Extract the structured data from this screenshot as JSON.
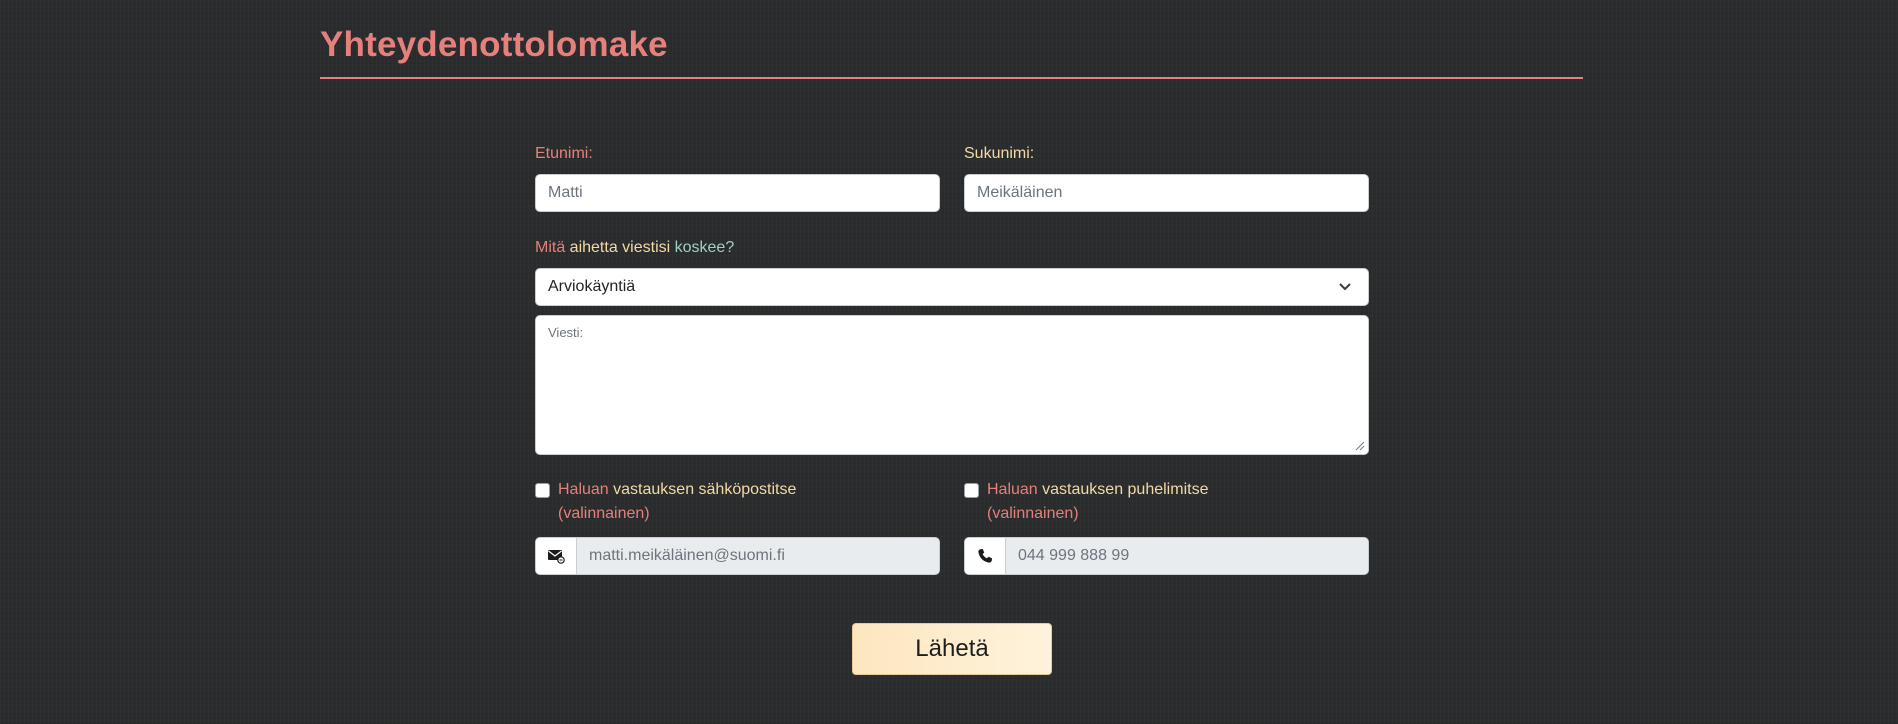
{
  "header": {
    "title": "Yhteydenottolomake"
  },
  "form": {
    "first_name": {
      "label": "Etunimi:",
      "placeholder": "Matti"
    },
    "last_name": {
      "label": "Sukunimi:",
      "placeholder": "Meikäläinen"
    },
    "topic": {
      "label_parts": [
        "Mitä",
        " aihetta viestisi",
        " koskee?"
      ],
      "selected": "Arviokäyntiä"
    },
    "message": {
      "placeholder": "Viesti:"
    },
    "email_opt": {
      "label_parts": [
        "Haluan",
        " vastauksen sähköpostitse",
        "(valinnainen)"
      ],
      "checked": false,
      "icon": "envelope-icon",
      "placeholder": "matti.meikäläinen@suomi.fi"
    },
    "phone_opt": {
      "label_parts": [
        "Haluan",
        " vastauksen puhelimitse",
        "(valinnainen)"
      ],
      "checked": false,
      "icon": "phone-icon",
      "placeholder": "044 999 888 99"
    },
    "submit_label": "Lähetä"
  },
  "colors": {
    "accent": "#e5807c",
    "cream": "#f4d8a6",
    "mint": "#9fd1c4",
    "background": "#2a2c2d",
    "button": "#fde6bf"
  }
}
